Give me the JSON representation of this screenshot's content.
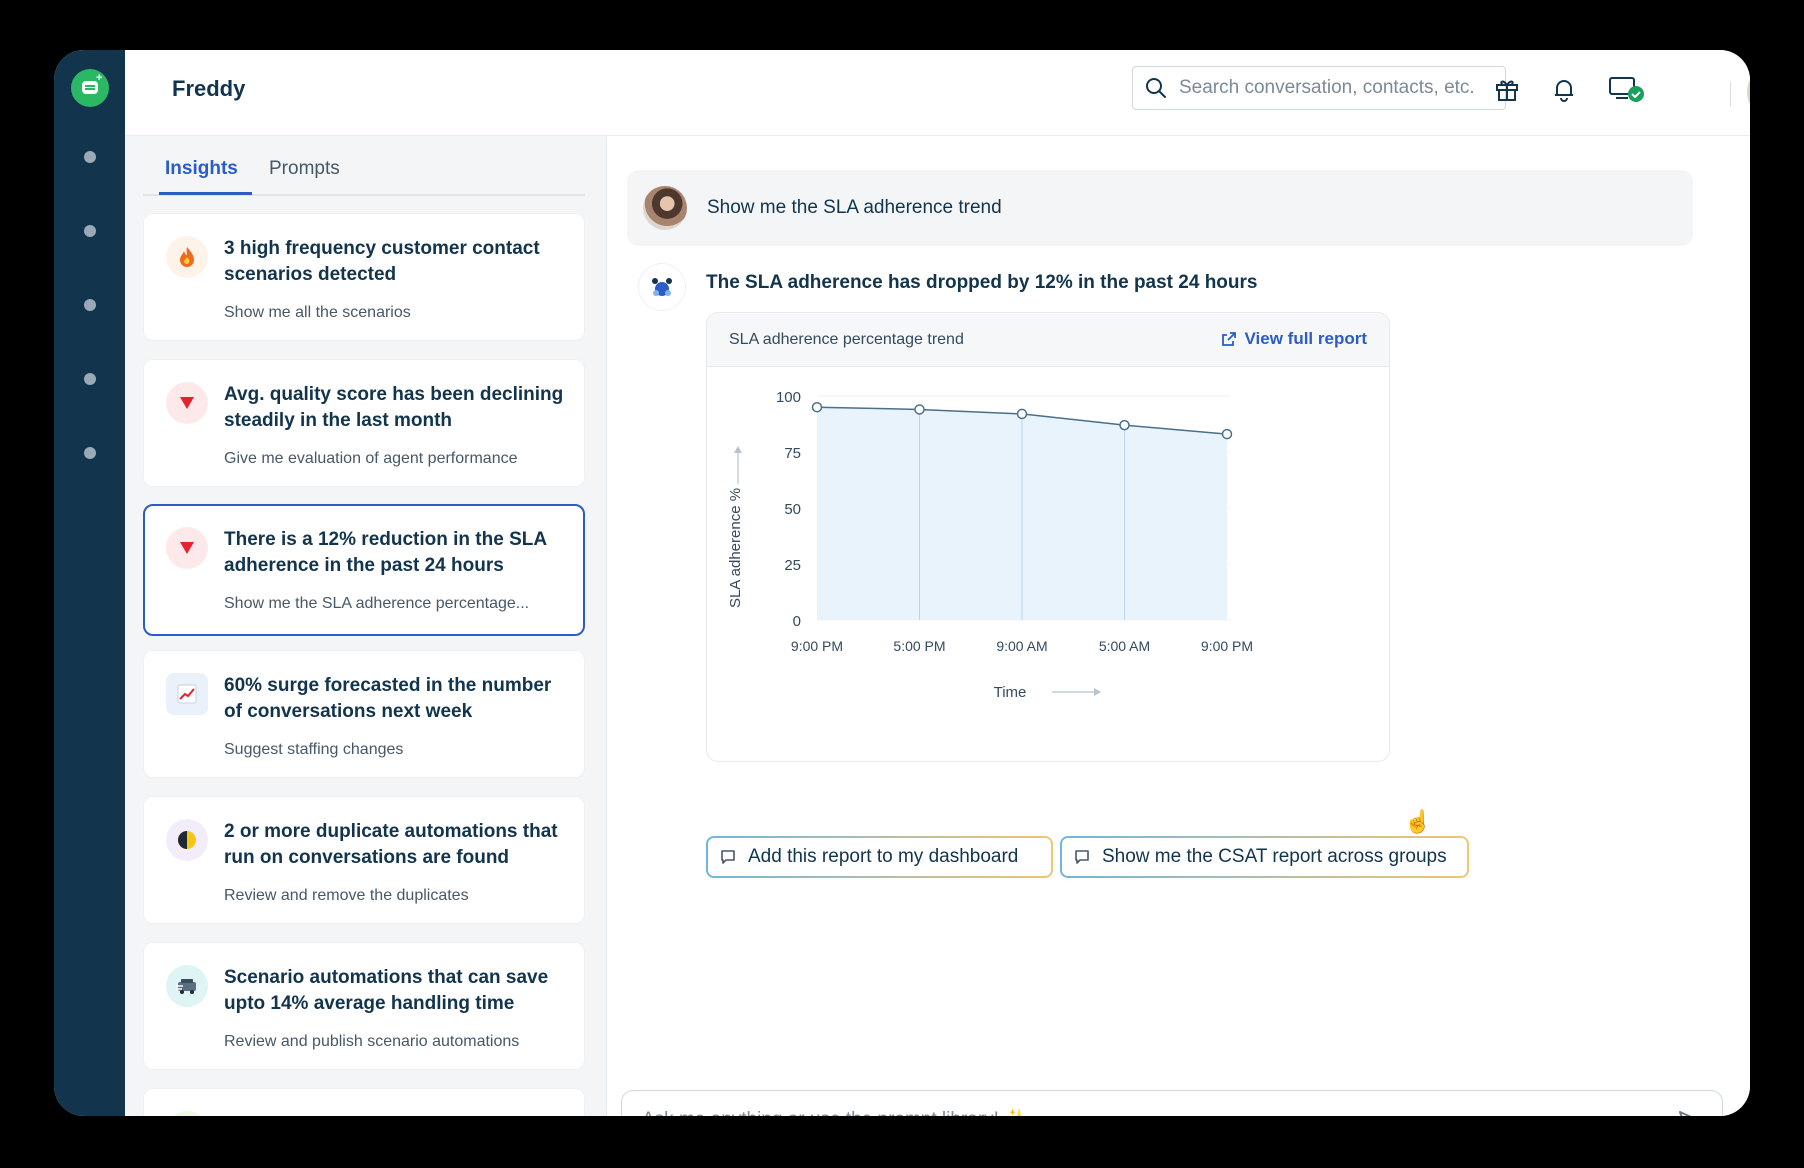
{
  "app": {
    "title": "Freddy"
  },
  "search": {
    "placeholder": "Search conversation, contacts, etc."
  },
  "tabs": [
    {
      "label": "Insights"
    },
    {
      "label": "Prompts"
    }
  ],
  "insights": [
    {
      "icon": "flame-icon",
      "title": "3 high frequency customer contact scenarios detected",
      "prompt": "Show me all the scenarios"
    },
    {
      "icon": "down-triangle-icon",
      "title": "Avg. quality score has been declining steadily in the last month",
      "prompt": "Give me evaluation of agent performance"
    },
    {
      "icon": "down-triangle-icon",
      "title": "There is a 12% reduction in the SLA adherence in the past 24 hours",
      "prompt": "Show me the SLA adherence percentage..."
    },
    {
      "icon": "chart-increase-icon",
      "title": "60% surge forecasted in the number of conversations next week",
      "prompt": "Suggest staffing changes"
    },
    {
      "icon": "half-circle-icon",
      "title": "2 or more duplicate automations that run on conversations are found",
      "prompt": "Review and remove the duplicates"
    },
    {
      "icon": "automation-icon",
      "title": "Scenario automations that can save upto 14% average handling time",
      "prompt": "Review and publish scenario automations"
    }
  ],
  "conversation": {
    "user_message": "Show me the SLA adherence trend",
    "bot_headline": "The SLA adherence has dropped by 12% in the past 24 hours",
    "card_title": "SLA adherence percentage trend",
    "view_report": "View full report",
    "suggestions": [
      {
        "label": "Add this report to my dashboard"
      },
      {
        "label": "Show me the CSAT report across groups"
      }
    ]
  },
  "composer": {
    "placeholder": "Ask me anything or use the prompt library! ✨"
  },
  "colors": {
    "accent": "#2c5cc5",
    "rail": "#12344d",
    "series_line": "#4a6f8a",
    "series_fill": "#e9f3fc"
  },
  "chart_data": {
    "type": "area",
    "x": [
      "9:00 PM",
      "5:00 PM",
      "9:00 AM",
      "5:00 AM",
      "9:00 PM"
    ],
    "values": [
      95,
      94,
      92,
      87,
      83
    ],
    "xlabel": "Time",
    "ylabel": "SLA adherence %",
    "ylim": [
      0,
      100
    ],
    "yticks": [
      0,
      25,
      50,
      75,
      100
    ],
    "grid": true
  }
}
